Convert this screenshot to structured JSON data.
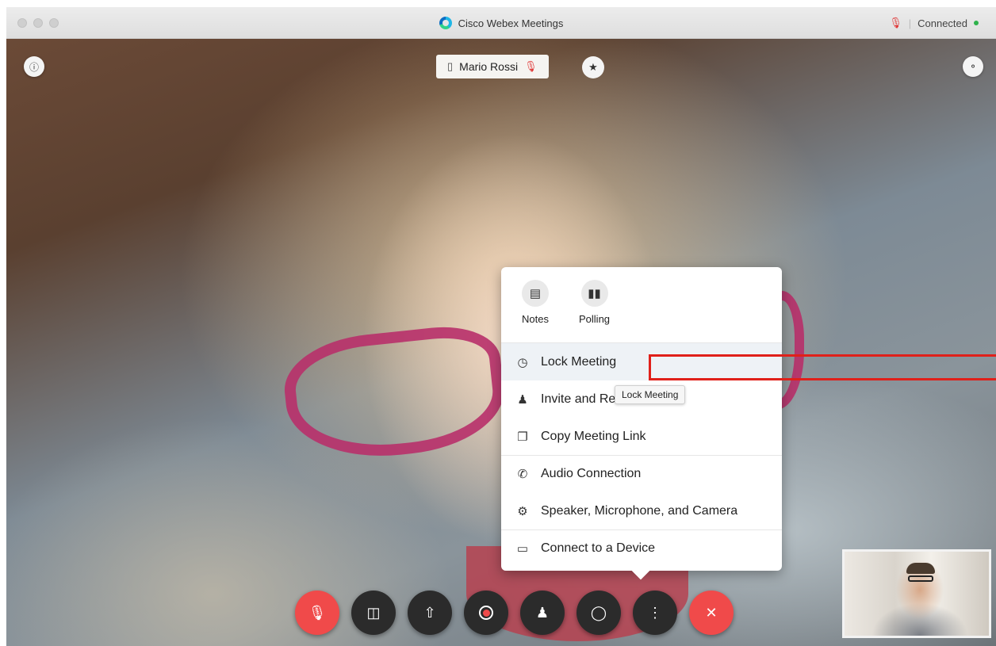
{
  "window": {
    "title": "Cisco Webex Meetings",
    "status_text": "Connected",
    "status_color": "#2fb24c"
  },
  "overlay": {
    "participant_name": "Mario Rossi",
    "icons": [
      "info-icon",
      "phone-icon",
      "muted-mic-icon",
      "pin-icon",
      "layout-icon"
    ]
  },
  "menu": {
    "quick_actions": [
      {
        "label": "Notes",
        "icon": "notes-icon"
      },
      {
        "label": "Polling",
        "icon": "polling-icon"
      }
    ],
    "items": [
      {
        "label": "Lock Meeting",
        "icon": "lock-icon"
      },
      {
        "label": "Invite and Remind",
        "icon": "invite-icon"
      },
      {
        "label": "Copy Meeting Link",
        "icon": "copy-icon"
      },
      {
        "label": "Audio Connection",
        "icon": "phone-icon"
      },
      {
        "label": "Speaker, Microphone, and Camera",
        "icon": "gear-icon"
      },
      {
        "label": "Connect to a Device",
        "icon": "cast-icon"
      }
    ],
    "tooltip": "Lock Meeting"
  },
  "controls": [
    {
      "name": "mute",
      "icon": "muted-mic-icon",
      "color": "#f04a4a"
    },
    {
      "name": "video",
      "icon": "video-off-icon"
    },
    {
      "name": "share",
      "icon": "share-icon"
    },
    {
      "name": "record",
      "icon": "record-icon"
    },
    {
      "name": "participants",
      "icon": "participants-icon"
    },
    {
      "name": "chat",
      "icon": "chat-icon"
    },
    {
      "name": "more",
      "icon": "more-icon"
    },
    {
      "name": "leave",
      "icon": "close-icon",
      "color": "#f04a4a"
    }
  ],
  "colors": {
    "accent_red": "#e0201a",
    "lock_bar_highlight": "#eef2f6"
  }
}
